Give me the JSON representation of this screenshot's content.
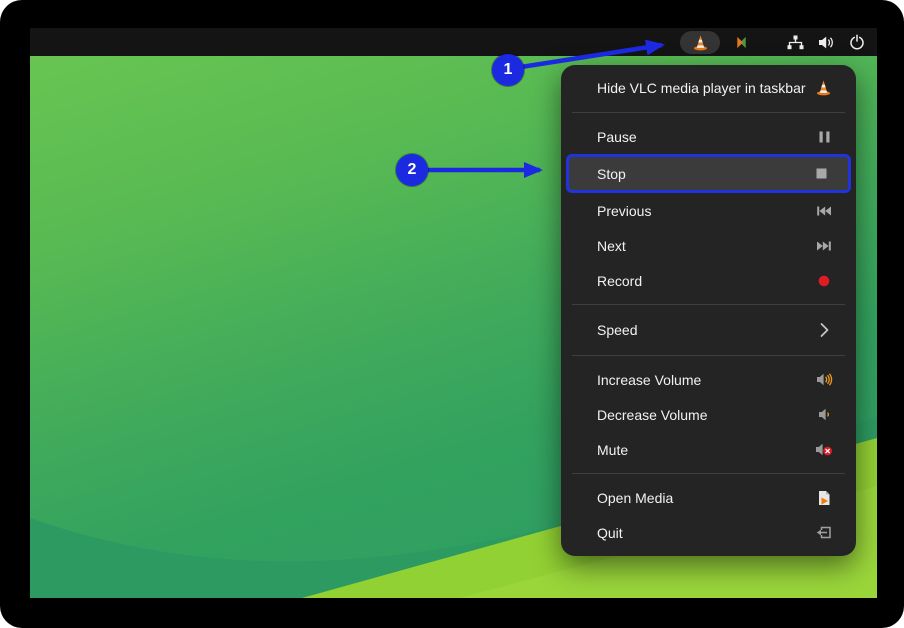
{
  "topbar": {
    "tray_icons": [
      {
        "name": "vlc",
        "label": "VLC media player tray icon",
        "active": true
      },
      {
        "name": "indicator",
        "label": "app indicator icon"
      },
      {
        "name": "network",
        "label": "network icon"
      },
      {
        "name": "volume",
        "label": "volume icon"
      },
      {
        "name": "power",
        "label": "power icon"
      }
    ]
  },
  "menu": {
    "header": {
      "label": "Hide VLC media player in taskbar",
      "icon": "vlc-cone-icon"
    },
    "items": [
      {
        "label": "Pause",
        "icon": "pause-icon"
      },
      {
        "label": "Stop",
        "icon": "stop-icon",
        "selected": true
      },
      {
        "label": "Previous",
        "icon": "previous-icon"
      },
      {
        "label": "Next",
        "icon": "next-icon"
      },
      {
        "label": "Record",
        "icon": "record-icon"
      },
      {
        "label": "Speed",
        "icon": "chevron-right-icon",
        "has_submenu": true
      },
      {
        "label": "Increase Volume",
        "icon": "volume-up-icon"
      },
      {
        "label": "Decrease Volume",
        "icon": "volume-down-icon"
      },
      {
        "label": "Mute",
        "icon": "volume-mute-icon"
      },
      {
        "label": "Open Media",
        "icon": "open-media-icon"
      },
      {
        "label": "Quit",
        "icon": "quit-icon"
      }
    ]
  },
  "annotations": [
    {
      "number": "1",
      "target": "vlc-tray-icon"
    },
    {
      "number": "2",
      "target": "menu-item-stop"
    }
  ],
  "colors": {
    "annotation_blue": "#1b2ae0",
    "selection_border_blue": "#2133dc",
    "record_red": "#e01b24",
    "vlc_orange": "#f58220",
    "menu_bg": "#242424",
    "topbar_bg": "#141414",
    "wallpaper_green_top": "#68c552",
    "wallpaper_green_mid": "#33a25f",
    "wallpaper_lime": "#92d134"
  }
}
